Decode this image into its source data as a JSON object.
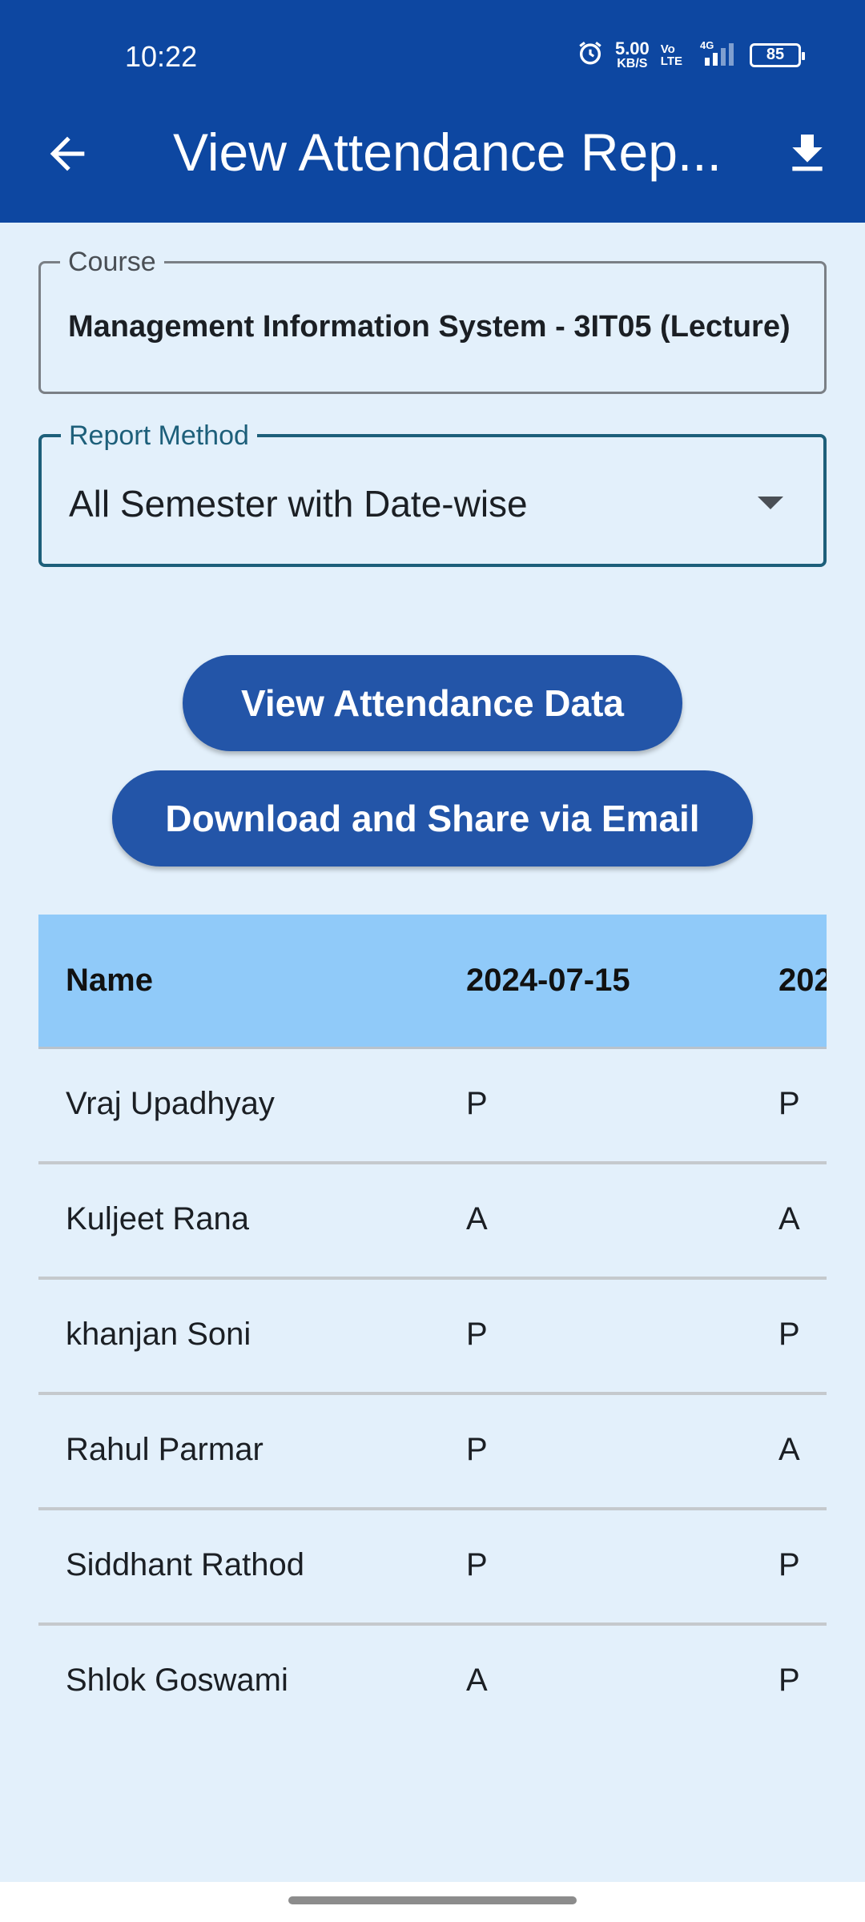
{
  "status_bar": {
    "time": "10:22",
    "net_speed_value": "5.00",
    "net_speed_unit": "KB/S",
    "volte_top": "Vo",
    "volte_bottom": "LTE",
    "network": "4G",
    "battery": "85"
  },
  "app_bar": {
    "title": "View Attendance Rep...",
    "back_icon": "arrow-left-icon",
    "download_icon": "download-icon"
  },
  "course": {
    "label": "Course",
    "value": "Management Information System  - 3IT05 (Lecture)"
  },
  "report_method": {
    "label": "Report Method",
    "selected": "All Semester with Date-wise"
  },
  "buttons": {
    "view": "View Attendance Data",
    "email": "Download and Share via Email"
  },
  "table": {
    "headers": [
      "Name",
      "2024-07-15",
      "202"
    ],
    "rows": [
      [
        "Vraj Upadhyay",
        "P",
        "P"
      ],
      [
        "Kuljeet Rana",
        "A",
        "A"
      ],
      [
        "khanjan Soni",
        "P",
        "P"
      ],
      [
        "Rahul Parmar",
        "P",
        "A"
      ],
      [
        "Siddhant Rathod",
        "P",
        "P"
      ],
      [
        "Shlok Goswami",
        "A",
        "P"
      ]
    ]
  },
  "colors": {
    "primary": "#0d47a1",
    "button": "#2355a8",
    "background": "#e3f0fb",
    "table_header": "#90caf9",
    "accent": "#1d5f7a"
  }
}
